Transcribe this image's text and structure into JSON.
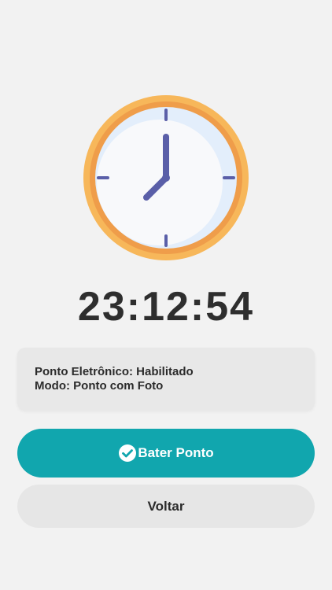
{
  "clock": {
    "icon": "analog-clock-icon",
    "time": "23:12:54"
  },
  "info": {
    "line1": "Ponto Eletrônico: Habilitado",
    "line2": "Modo: Ponto com Foto"
  },
  "buttons": {
    "primary_label": "Bater Ponto",
    "primary_icon": "check-circle-icon",
    "secondary_label": "Voltar"
  },
  "colors": {
    "background": "#f2f2f2",
    "accent": "#11a6ae",
    "clock_rim": "#f7b75a",
    "clock_hands": "#5a5fa8"
  }
}
